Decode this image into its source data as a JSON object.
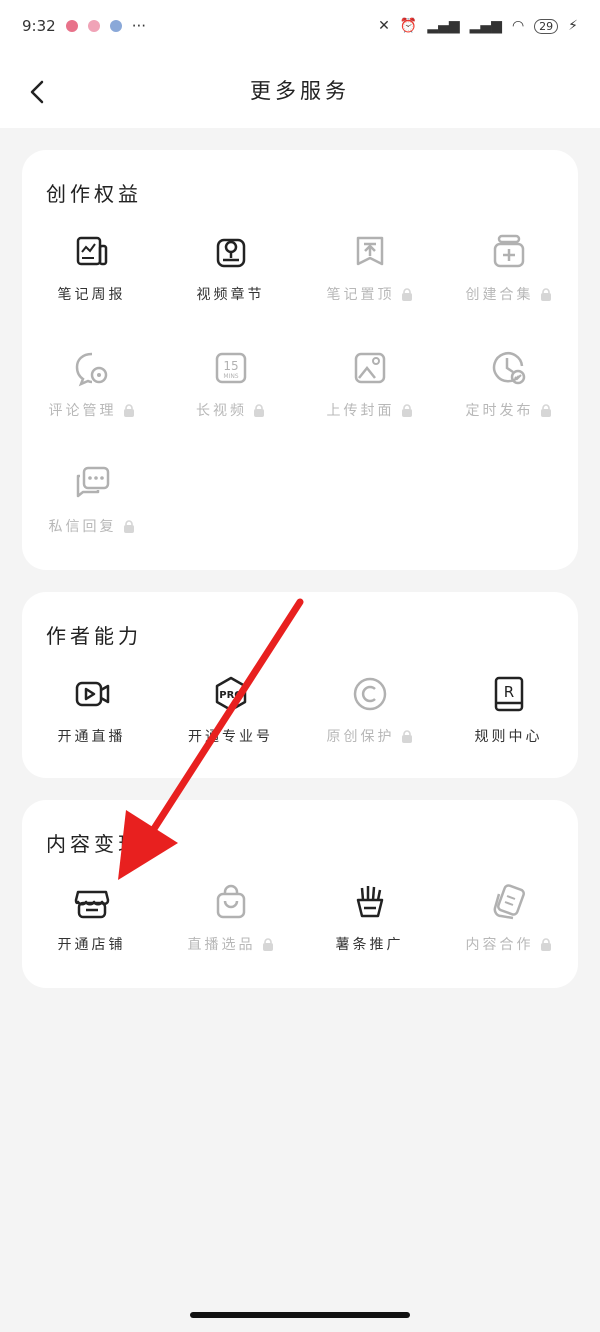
{
  "status_bar": {
    "time": "9:32",
    "battery": "29"
  },
  "header": {
    "title": "更多服务"
  },
  "sections": [
    {
      "title": "创作权益",
      "items": [
        {
          "label": "笔记周报",
          "icon": "report-icon",
          "locked": false
        },
        {
          "label": "视频章节",
          "icon": "video-chapter-icon",
          "locked": false
        },
        {
          "label": "笔记置顶",
          "icon": "pin-top-icon",
          "locked": true
        },
        {
          "label": "创建合集",
          "icon": "collection-add-icon",
          "locked": true
        },
        {
          "label": "评论管理",
          "icon": "comment-manage-icon",
          "locked": true
        },
        {
          "label": "长视频",
          "icon": "long-video-icon",
          "locked": true
        },
        {
          "label": "上传封面",
          "icon": "upload-cover-icon",
          "locked": true
        },
        {
          "label": "定时发布",
          "icon": "scheduled-publish-icon",
          "locked": true
        },
        {
          "label": "私信回复",
          "icon": "message-reply-icon",
          "locked": true
        }
      ]
    },
    {
      "title": "作者能力",
      "items": [
        {
          "label": "开通直播",
          "icon": "live-video-icon",
          "locked": false
        },
        {
          "label": "开通专业号",
          "icon": "pro-badge-icon",
          "locked": false
        },
        {
          "label": "原创保护",
          "icon": "copyright-icon",
          "locked": true
        },
        {
          "label": "规则中心",
          "icon": "rule-book-icon",
          "locked": false
        }
      ]
    },
    {
      "title": "内容变现",
      "items": [
        {
          "label": "开通店铺",
          "icon": "shop-icon",
          "locked": false
        },
        {
          "label": "直播选品",
          "icon": "shopping-bag-icon",
          "locked": true
        },
        {
          "label": "薯条推广",
          "icon": "fries-promo-icon",
          "locked": false
        },
        {
          "label": "内容合作",
          "icon": "cooperation-icon",
          "locked": true
        }
      ]
    }
  ],
  "colors": {
    "accent_arrow": "#e8201f",
    "background": "#f4f4f4",
    "card": "#ffffff",
    "disabled_text": "#b8b8b8"
  }
}
